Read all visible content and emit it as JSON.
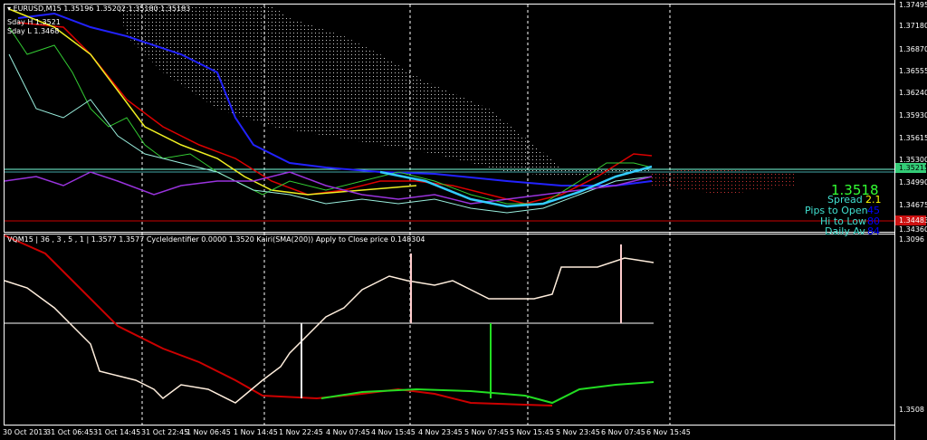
{
  "header": {
    "symbol": "EURUSD,M15",
    "quotes": "1.35196 1.35202 1.35180 1.35183",
    "sday_h": "Sday H 1.3521",
    "sday_l": "Sday L 1.3468"
  },
  "price_axis": [
    "1.37495",
    "1.37180",
    "1.36870",
    "1.36555",
    "1.36240",
    "1.35930",
    "1.35615",
    "1.35300",
    "1.34990",
    "1.34675",
    "1.34360"
  ],
  "current_price_tag": "1.35215",
  "red_price_tag": "1.34483",
  "info_panel": {
    "price": "1.3518",
    "spread_label": "Spread",
    "spread": "2.1",
    "pips_open_label": "Pips to Open",
    "pips_open": "45",
    "hi_low_label": "Hi to Low",
    "hi_low": "80",
    "daily_av_label": "Daily Av",
    "daily_av": "84",
    "colors": {
      "price": "#33ff33",
      "label": "#40e0d0",
      "spread": "#ffff00",
      "value": "#0000ff"
    }
  },
  "indicator": {
    "header": "VQM15 | 36 , 3 , 5 , 1 | 1.3577 1.3577 CycleIdentifier 0.0000 1.3520 Kairi(SMA(200)) Apply to Close price 0.148304",
    "axis_top": "1.3096",
    "axis_bottom": "1.3508"
  },
  "time_axis": [
    "30 Oct 2013",
    "31 Oct 06:45",
    "31 Oct 14:45",
    "31 Oct 22:45",
    "1 Nov 06:45",
    "1 Nov 14:45",
    "1 Nov 22:45",
    "4 Nov 07:45",
    "4 Nov 15:45",
    "4 Nov 23:45",
    "5 Nov 07:45",
    "5 Nov 15:45",
    "5 Nov 23:45",
    "6 Nov 07:45",
    "6 Nov 15:45"
  ]
}
